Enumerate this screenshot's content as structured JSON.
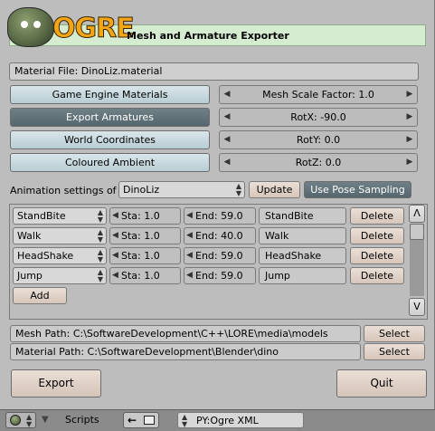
{
  "header": {
    "logo_text": "OGRE",
    "title": "Mesh and Armature Exporter"
  },
  "material_file": "Material File: DinoLiz.material",
  "toggles": [
    {
      "label": "Game Engine Materials",
      "active": false
    },
    {
      "label": "Export Armatures",
      "active": true
    },
    {
      "label": "World Coordinates",
      "active": false
    },
    {
      "label": "Coloured Ambient",
      "active": false
    }
  ],
  "number_fields": [
    {
      "label": "Mesh Scale Factor: 1.0"
    },
    {
      "label": "RotX: -90.0"
    },
    {
      "label": "RotY: 0.0"
    },
    {
      "label": "RotZ: 0.0"
    }
  ],
  "animation": {
    "settings_label": "Animation settings of",
    "armature": "DinoLiz",
    "update_label": "Update",
    "pose_sampling_label": "Use Pose Sampling",
    "add_label": "Add",
    "delete_label": "Delete",
    "rows": [
      {
        "action": "StandBite",
        "start": "Sta: 1.0",
        "end": "End: 59.0",
        "name": "StandBite"
      },
      {
        "action": "Walk",
        "start": "Sta: 1.0",
        "end": "End: 40.0",
        "name": "Walk"
      },
      {
        "action": "HeadShake",
        "start": "Sta: 1.0",
        "end": "End: 59.0",
        "name": "HeadShake"
      },
      {
        "action": "Jump",
        "start": "Sta: 1.0",
        "end": "End: 59.0",
        "name": "Jump"
      }
    ],
    "scroll_up": "Λ",
    "scroll_down": "V"
  },
  "paths": {
    "mesh_path": "Mesh Path: C:\\SoftwareDevelopment\\C++\\LORE\\media\\models",
    "material_path": "Material Path: C:\\SoftwareDevelopment\\Blender\\dino",
    "select_label": "Select"
  },
  "actions": {
    "export_label": "Export",
    "quit_label": "Quit"
  },
  "bottom_bar": {
    "scripts_label": "Scripts",
    "script_name": "PY:Ogre XML"
  },
  "colors": {
    "panel_bg": "#bdbdbd",
    "header_bg": "#d6ecd0",
    "toggle_on": "#5f7075",
    "toggle_off": "#c8d9de",
    "action_button": "#e0d2c7"
  }
}
